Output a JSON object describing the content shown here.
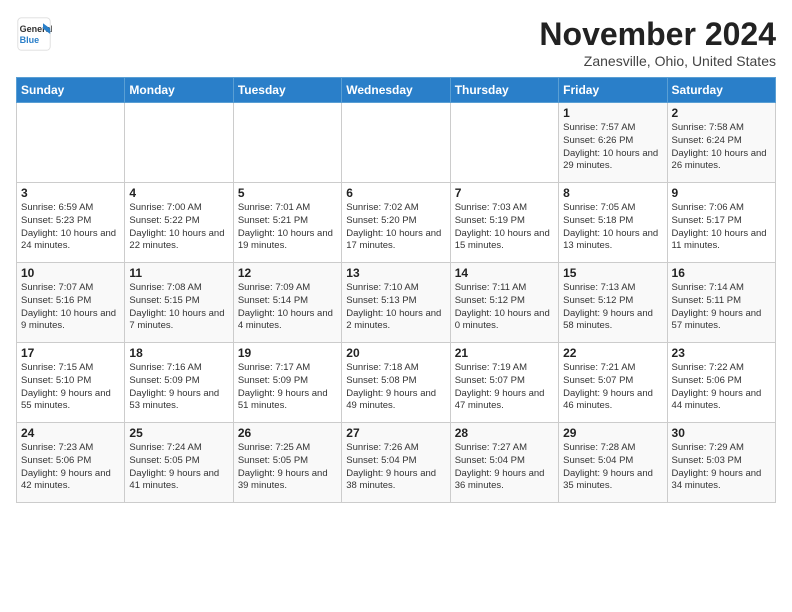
{
  "header": {
    "logo_general": "General",
    "logo_blue": "Blue",
    "month_title": "November 2024",
    "location": "Zanesville, Ohio, United States"
  },
  "weekdays": [
    "Sunday",
    "Monday",
    "Tuesday",
    "Wednesday",
    "Thursday",
    "Friday",
    "Saturday"
  ],
  "weeks": [
    [
      {
        "day": "",
        "info": ""
      },
      {
        "day": "",
        "info": ""
      },
      {
        "day": "",
        "info": ""
      },
      {
        "day": "",
        "info": ""
      },
      {
        "day": "",
        "info": ""
      },
      {
        "day": "1",
        "info": "Sunrise: 7:57 AM\nSunset: 6:26 PM\nDaylight: 10 hours and 29 minutes."
      },
      {
        "day": "2",
        "info": "Sunrise: 7:58 AM\nSunset: 6:24 PM\nDaylight: 10 hours and 26 minutes."
      }
    ],
    [
      {
        "day": "3",
        "info": "Sunrise: 6:59 AM\nSunset: 5:23 PM\nDaylight: 10 hours and 24 minutes."
      },
      {
        "day": "4",
        "info": "Sunrise: 7:00 AM\nSunset: 5:22 PM\nDaylight: 10 hours and 22 minutes."
      },
      {
        "day": "5",
        "info": "Sunrise: 7:01 AM\nSunset: 5:21 PM\nDaylight: 10 hours and 19 minutes."
      },
      {
        "day": "6",
        "info": "Sunrise: 7:02 AM\nSunset: 5:20 PM\nDaylight: 10 hours and 17 minutes."
      },
      {
        "day": "7",
        "info": "Sunrise: 7:03 AM\nSunset: 5:19 PM\nDaylight: 10 hours and 15 minutes."
      },
      {
        "day": "8",
        "info": "Sunrise: 7:05 AM\nSunset: 5:18 PM\nDaylight: 10 hours and 13 minutes."
      },
      {
        "day": "9",
        "info": "Sunrise: 7:06 AM\nSunset: 5:17 PM\nDaylight: 10 hours and 11 minutes."
      }
    ],
    [
      {
        "day": "10",
        "info": "Sunrise: 7:07 AM\nSunset: 5:16 PM\nDaylight: 10 hours and 9 minutes."
      },
      {
        "day": "11",
        "info": "Sunrise: 7:08 AM\nSunset: 5:15 PM\nDaylight: 10 hours and 7 minutes."
      },
      {
        "day": "12",
        "info": "Sunrise: 7:09 AM\nSunset: 5:14 PM\nDaylight: 10 hours and 4 minutes."
      },
      {
        "day": "13",
        "info": "Sunrise: 7:10 AM\nSunset: 5:13 PM\nDaylight: 10 hours and 2 minutes."
      },
      {
        "day": "14",
        "info": "Sunrise: 7:11 AM\nSunset: 5:12 PM\nDaylight: 10 hours and 0 minutes."
      },
      {
        "day": "15",
        "info": "Sunrise: 7:13 AM\nSunset: 5:12 PM\nDaylight: 9 hours and 58 minutes."
      },
      {
        "day": "16",
        "info": "Sunrise: 7:14 AM\nSunset: 5:11 PM\nDaylight: 9 hours and 57 minutes."
      }
    ],
    [
      {
        "day": "17",
        "info": "Sunrise: 7:15 AM\nSunset: 5:10 PM\nDaylight: 9 hours and 55 minutes."
      },
      {
        "day": "18",
        "info": "Sunrise: 7:16 AM\nSunset: 5:09 PM\nDaylight: 9 hours and 53 minutes."
      },
      {
        "day": "19",
        "info": "Sunrise: 7:17 AM\nSunset: 5:09 PM\nDaylight: 9 hours and 51 minutes."
      },
      {
        "day": "20",
        "info": "Sunrise: 7:18 AM\nSunset: 5:08 PM\nDaylight: 9 hours and 49 minutes."
      },
      {
        "day": "21",
        "info": "Sunrise: 7:19 AM\nSunset: 5:07 PM\nDaylight: 9 hours and 47 minutes."
      },
      {
        "day": "22",
        "info": "Sunrise: 7:21 AM\nSunset: 5:07 PM\nDaylight: 9 hours and 46 minutes."
      },
      {
        "day": "23",
        "info": "Sunrise: 7:22 AM\nSunset: 5:06 PM\nDaylight: 9 hours and 44 minutes."
      }
    ],
    [
      {
        "day": "24",
        "info": "Sunrise: 7:23 AM\nSunset: 5:06 PM\nDaylight: 9 hours and 42 minutes."
      },
      {
        "day": "25",
        "info": "Sunrise: 7:24 AM\nSunset: 5:05 PM\nDaylight: 9 hours and 41 minutes."
      },
      {
        "day": "26",
        "info": "Sunrise: 7:25 AM\nSunset: 5:05 PM\nDaylight: 9 hours and 39 minutes."
      },
      {
        "day": "27",
        "info": "Sunrise: 7:26 AM\nSunset: 5:04 PM\nDaylight: 9 hours and 38 minutes."
      },
      {
        "day": "28",
        "info": "Sunrise: 7:27 AM\nSunset: 5:04 PM\nDaylight: 9 hours and 36 minutes."
      },
      {
        "day": "29",
        "info": "Sunrise: 7:28 AM\nSunset: 5:04 PM\nDaylight: 9 hours and 35 minutes."
      },
      {
        "day": "30",
        "info": "Sunrise: 7:29 AM\nSunset: 5:03 PM\nDaylight: 9 hours and 34 minutes."
      }
    ]
  ]
}
